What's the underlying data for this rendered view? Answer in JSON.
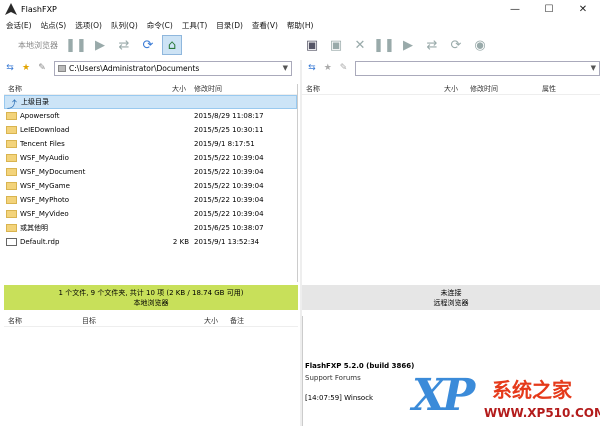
{
  "window": {
    "title": "FlashFXP",
    "min": "—",
    "max": "☐",
    "close": "✕"
  },
  "menu": [
    "会话(E)",
    "站点(S)",
    "选项(O)",
    "队列(Q)",
    "命令(C)",
    "工具(T)",
    "目录(D)",
    "查看(V)",
    "帮助(H)"
  ],
  "toolbar": {
    "connect_label": "本地浏览器"
  },
  "local": {
    "path": "C:\\Users\\Administrator\\Documents",
    "columns": {
      "name": "名称",
      "size": "大小",
      "modified": "修改时间"
    },
    "rows": [
      {
        "name": "上级目录",
        "size": "",
        "date": ""
      },
      {
        "name": "Apowersoft",
        "size": "",
        "date": "2015/8/29 11:08:17"
      },
      {
        "name": "LeIEDownload",
        "size": "",
        "date": "2015/5/25 10:30:11"
      },
      {
        "name": "Tencent Files",
        "size": "",
        "date": "2015/9/1 8:17:51"
      },
      {
        "name": "WSF_MyAudio",
        "size": "",
        "date": "2015/5/22 10:39:04"
      },
      {
        "name": "WSF_MyDocument",
        "size": "",
        "date": "2015/5/22 10:39:04"
      },
      {
        "name": "WSF_MyGame",
        "size": "",
        "date": "2015/5/22 10:39:04"
      },
      {
        "name": "WSF_MyPhoto",
        "size": "",
        "date": "2015/5/22 10:39:04"
      },
      {
        "name": "WSF_MyVideo",
        "size": "",
        "date": "2015/5/22 10:39:04"
      },
      {
        "name": "或其他明",
        "size": "",
        "date": "2015/6/25 10:38:07"
      },
      {
        "name": "Default.rdp",
        "size": "2 KB",
        "date": "2015/9/1 13:52:34"
      }
    ],
    "status_line1": "1 个文件, 9 个文件夹, 共计 10 项 (2 KB / 18.74 GB 可用)",
    "status_line2": "本地浏览器"
  },
  "remote": {
    "columns": {
      "name": "名称",
      "size": "大小",
      "modified": "修改时间",
      "attr": "属性"
    },
    "status_line1": "未连接",
    "status_line2": "远程浏览器"
  },
  "queue": {
    "columns": {
      "name": "名称",
      "target": "目标",
      "size": "大小",
      "note": "备注"
    }
  },
  "log": {
    "line1": "FlashFXP 5.2.0 (build 3866)",
    "line2": "Support Forums",
    "line3": "[14:07:59]  Winsock"
  },
  "watermark": {
    "xp": "XP",
    "brand": "系统之家",
    "url": "WWW.XP510.COM"
  }
}
